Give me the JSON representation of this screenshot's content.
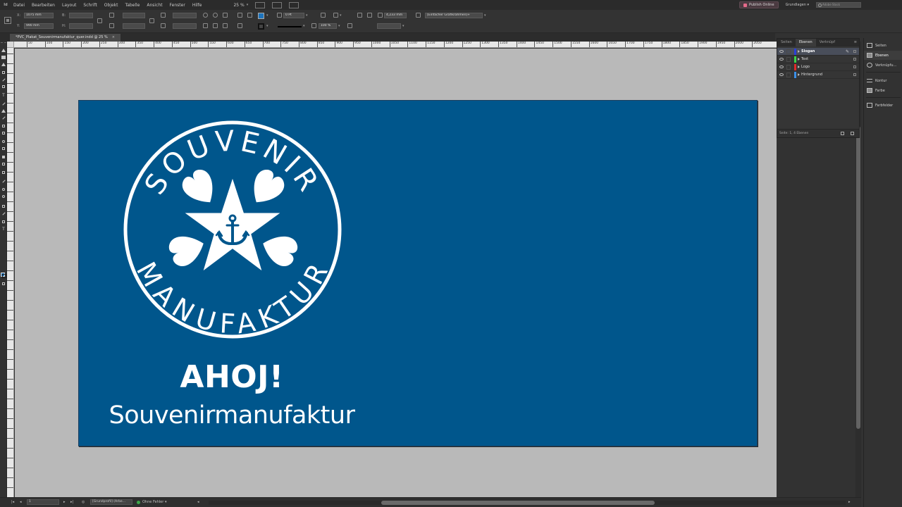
{
  "menu": {
    "items": [
      "Datei",
      "Bearbeiten",
      "Layout",
      "Schrift",
      "Objekt",
      "Tabelle",
      "Ansicht",
      "Fenster",
      "Hilfe"
    ],
    "zoom": "25 %",
    "publish_online": "Publish Online",
    "workspace": "Grundlagen",
    "stock_search_placeholder": "Adobe Stock"
  },
  "control": {
    "x_label": "X:",
    "y_label": "Y:",
    "w_label": "B:",
    "h_label": "H:",
    "x_value": "1075 mm",
    "y_value": "990 mm",
    "stroke_weight": "0 Pt",
    "opacity": "100 %",
    "offset_value": "4,233 mm",
    "object_style": "[Einfacher Grafikrahmen]+",
    "fill_color": "#1d74bd"
  },
  "document": {
    "tab_title": "*PVC_Plakat_Souvenirmanufaktur_quer.indd @ 25 %",
    "ruler_ticks": [
      "50",
      "100",
      "150",
      "200",
      "250",
      "300",
      "350",
      "400",
      "450",
      "500",
      "550",
      "600",
      "650",
      "700",
      "750",
      "800",
      "850",
      "900",
      "950",
      "1000",
      "1050",
      "1100",
      "1150",
      "1200",
      "1250",
      "1300",
      "1350",
      "1400",
      "1450",
      "1500",
      "1550",
      "1600",
      "1650",
      "1700",
      "1750",
      "1800",
      "1850",
      "1900",
      "1950",
      "2000",
      "2050"
    ],
    "page_background": "#00568c"
  },
  "artwork": {
    "logo_top_text": "SOUVENIR",
    "logo_bottom_text": "MANUFAKTUR",
    "title": "AHOJ!",
    "subtitle": "Souvenirmanufaktur",
    "text_color": "#ffffff"
  },
  "layers_panel": {
    "tabs": [
      "Seiten",
      "Ebenen",
      "Verknüpf"
    ],
    "active_tab": "Ebenen",
    "layers": [
      {
        "name": "Slogan",
        "color": "#2c3fd8",
        "selected": true
      },
      {
        "name": "Text",
        "color": "#3bd44a",
        "selected": false
      },
      {
        "name": "Logo",
        "color": "#e02a2a",
        "selected": false
      },
      {
        "name": "Hintergrund",
        "color": "#3c8fe6",
        "selected": false
      }
    ],
    "footer": "Seite: 1, 4 Ebenen"
  },
  "dock": {
    "items": [
      "Seiten",
      "Ebenen",
      "Verknüpfu…",
      "Kontur",
      "Farbe",
      "Farbfelder"
    ]
  },
  "status": {
    "page_number": "1",
    "master": "[Grundprofil] (Arbe…",
    "preflight": "Ohne Fehler"
  }
}
